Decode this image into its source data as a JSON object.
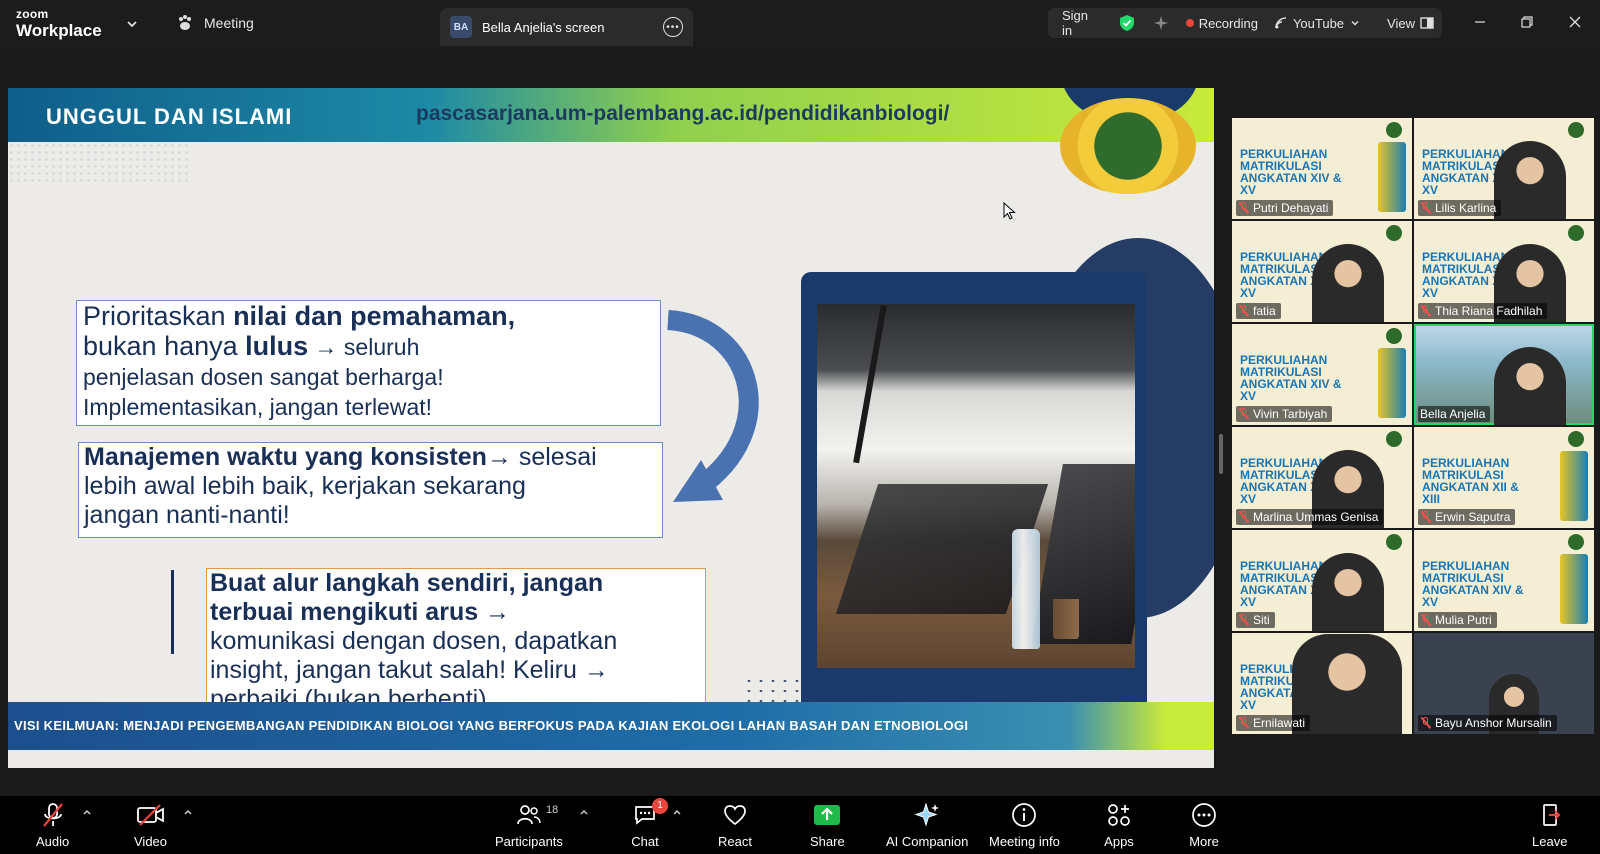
{
  "app": {
    "brand_top": "zoom",
    "brand_bottom": "Workplace"
  },
  "topbar": {
    "meeting_label": "Meeting",
    "screen_tab": {
      "avatar_initials": "BA",
      "label": "Bella Anjelia's screen"
    },
    "sign_in": "Sign in",
    "recording": "Recording",
    "youtube": "YouTube",
    "view": "View"
  },
  "slide": {
    "header_tag": "UNGGUL DAN ISLAMI",
    "header_url": "pascasarjana.um-palembang.ac.id/pendidikanbiologi/",
    "box1": {
      "a": "Prioritaskan ",
      "b": " nilai dan pemahaman,",
      "c": "bukan hanya ",
      "d": "lulus",
      "e": " → seluruh",
      "f": "penjelasan dosen sangat berharga!",
      "g": "Implementasikan, jangan terlewat!"
    },
    "box2": {
      "a": "Manajemen waktu yang konsisten→",
      "b": " selesai",
      "c": "lebih awal lebih baik, kerjakan sekarang",
      "d": "jangan nanti-nanti!"
    },
    "box3": {
      "a": "Buat alur langkah sendiri, jangan",
      "b": "terbuai mengikuti arus →",
      "c": "komunikasi dengan dosen, dapatkan",
      "d": "insight, jangan takut salah! Keliru →",
      "e": "perbaiki (bukan berhenti)"
    },
    "footer": "VISI KEILMUAN: MENJADI PENGEMBANGAN PENDIDIKAN BIOLOGI YANG BERFOKUS PADA KAJIAN EKOLOGI LAHAN BASAH DAN ETNOBIOLOGI"
  },
  "gallery": {
    "thumb_title": "PERKULIAHAN MATRIKULASI ANGKATAN XIV & XV",
    "thumb_title_alt": "PERKULIAHAN MATRIKULASI ANGKATAN XII & XIII",
    "participants": [
      {
        "name": "Putri Dehayati",
        "muted": true
      },
      {
        "name": "Lilis Karlina",
        "muted": true
      },
      {
        "name": "fatia",
        "muted": true
      },
      {
        "name": "Thia Riana Fadhilah",
        "muted": true
      },
      {
        "name": "Vivin Tarbiyah",
        "muted": true
      },
      {
        "name": "Bella Anjelia",
        "muted": false
      },
      {
        "name": "Marlina Ummas Genisa",
        "muted": true
      },
      {
        "name": "Erwin Saputra",
        "muted": true
      },
      {
        "name": "Siti",
        "muted": true
      },
      {
        "name": "Mulia Putri",
        "muted": true
      },
      {
        "name": "Ernilawati",
        "muted": true
      },
      {
        "name": "Bayu Anshor Mursalin",
        "muted": true
      }
    ]
  },
  "toolbar": {
    "audio": "Audio",
    "video": "Video",
    "participants": "Participants",
    "participants_count": "18",
    "chat": "Chat",
    "chat_badge": "1",
    "react": "React",
    "share": "Share",
    "ai_companion": "AI Companion",
    "meeting_info": "Meeting info",
    "apps": "Apps",
    "more": "More",
    "leave": "Leave"
  },
  "colors": {
    "accent_green": "#23d96b",
    "recording_red": "#e8453c",
    "share_green": "#1fba4a"
  }
}
